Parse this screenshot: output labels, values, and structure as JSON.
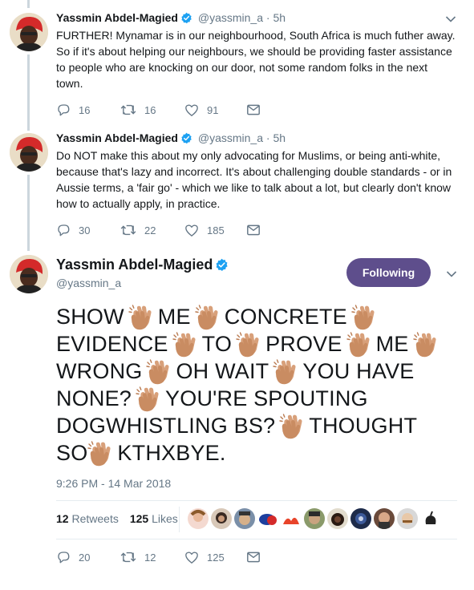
{
  "tweets": [
    {
      "name": "Yassmin Abdel-Magied",
      "handle": "@yassmin_a",
      "dot": "·",
      "time": "5h",
      "text": "FURTHER! Mynamar is in our neighbourhood, South Africa is much futher away. So if it's about helping our neighbours, we should be providing faster assistance to people who are knocking on our door, not some random folks in the next town.",
      "replies": "16",
      "retweets": "16",
      "likes": "91"
    },
    {
      "name": "Yassmin Abdel-Magied",
      "handle": "@yassmin_a",
      "dot": "·",
      "time": "5h",
      "text": "Do NOT make this about my only advocating for Muslims, or being anti-white, because that's lazy and incorrect. It's about challenging double standards - or in Aussie terms, a 'fair go' - which we like to talk about a lot, but clearly don't know how to actually apply, in practice.",
      "replies": "30",
      "retweets": "22",
      "likes": "185"
    }
  ],
  "main": {
    "name": "Yassmin Abdel-Magied",
    "handle": "@yassmin_a",
    "follow_label": "Following",
    "words": [
      "SHOW",
      "ME",
      "CONCRETE",
      "EVIDENCE",
      "TO",
      "PROVE",
      "ME",
      "WRONG",
      "OH WAIT",
      "YOU HAVE NONE?",
      "YOU'RE SPOUTING DOGWHISTLING BS?",
      "THOUGHT SO",
      "KTHXBYE."
    ],
    "timestamp": "9:26 PM - 14 Mar 2018",
    "retweet_count": "12",
    "retweet_label": "Retweets",
    "like_count": "125",
    "like_label": "Likes",
    "replies": "20",
    "retweets": "12",
    "likes": "125"
  },
  "colors": {
    "accent": "#1da1f2",
    "follow_button": "#5e4e8c",
    "secondary_text": "#657786",
    "thread_line": "#ccd6dd"
  },
  "icons": [
    "verified-icon",
    "chevron-down-icon",
    "reply-icon",
    "retweet-icon",
    "heart-icon",
    "message-icon",
    "clap-emoji"
  ]
}
